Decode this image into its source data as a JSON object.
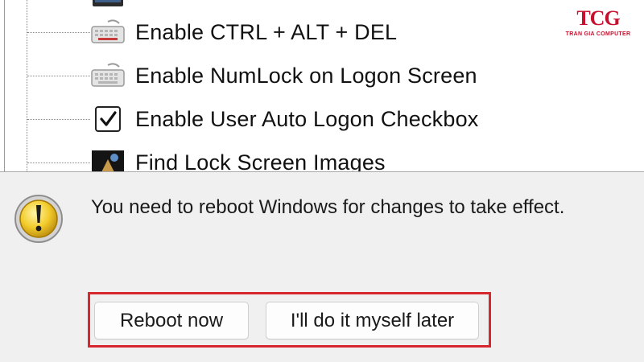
{
  "tree": {
    "items": [
      {
        "label": "",
        "icon": "computer-icon"
      },
      {
        "label": "Enable CTRL + ALT + DEL",
        "icon": "keyboard-icon"
      },
      {
        "label": "Enable NumLock on Logon Screen",
        "icon": "keyboard-icon"
      },
      {
        "label": "Enable User Auto Logon Checkbox",
        "icon": "checkbox-checked-icon"
      },
      {
        "label": "Find Lock Screen Images",
        "icon": "image-icon"
      }
    ]
  },
  "logo": {
    "mark": "TCG",
    "sub": "TRAN GIA COMPUTER",
    "color": "#c8102e"
  },
  "dialog": {
    "message": "You need to reboot Windows for changes to take effect.",
    "icon": "warning-icon",
    "buttons": {
      "reboot": "Reboot now",
      "later": "I'll do it myself later"
    },
    "highlight_color": "#d8262e"
  }
}
